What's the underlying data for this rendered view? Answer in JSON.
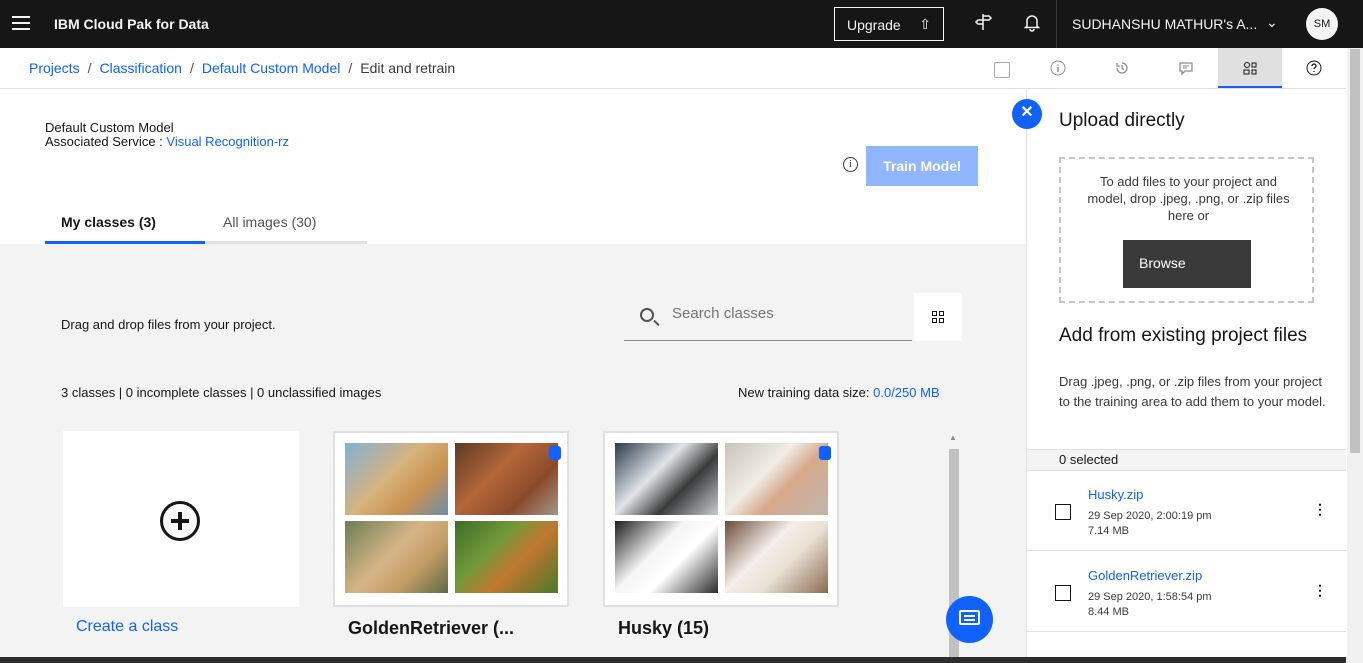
{
  "topbar": {
    "brand": "IBM Cloud Pak for Data",
    "upgrade_label": "Upgrade",
    "account": "SUDHANSHU MATHUR's A...",
    "avatar_initials": "SM"
  },
  "breadcrumb": {
    "items": [
      "Projects",
      "Classification",
      "Default Custom Model"
    ],
    "current": "Edit and retrain",
    "separator": "/"
  },
  "header": {
    "model_name": "Default Custom Model",
    "assoc_label": "Associated Service : ",
    "assoc_value": "Visual Recognition-rz",
    "train_label": "Train Model"
  },
  "tabs": {
    "my_classes": "My classes (3)",
    "all_images": "All images (30)"
  },
  "content": {
    "drag_text": "Drag and drop files from your project.",
    "search_placeholder": "Search classes",
    "stats": "3 classes | 0 incomplete classes | 0 unclassified images",
    "size_label": "New training data size: ",
    "size_value": "0.0/250 MB",
    "create_label": "Create a class",
    "classes": [
      {
        "title": "GoldenRetriever (..."
      },
      {
        "title": "Husky (15)"
      }
    ]
  },
  "right_panel": {
    "upload_title": "Upload directly",
    "drop_text": "To add files to your project and model, drop .jpeg, .png, or .zip files here or",
    "browse_label": "Browse",
    "existing_title": "Add from existing project files",
    "existing_desc": "Drag .jpeg, .png, or .zip files from your project to the training area to add them to your model.",
    "selected": "0 selected",
    "files": [
      {
        "name": "Husky.zip",
        "date": "29 Sep 2020, 2:00:19 pm",
        "size": "7.14 MB"
      },
      {
        "name": "GoldenRetriever.zip",
        "date": "29 Sep 2020, 1:58:54 pm",
        "size": "8.44 MB"
      }
    ]
  },
  "colors": {
    "accent": "#0f62fe",
    "topbar": "#161616",
    "train_disabled": "#8fb6ff"
  }
}
